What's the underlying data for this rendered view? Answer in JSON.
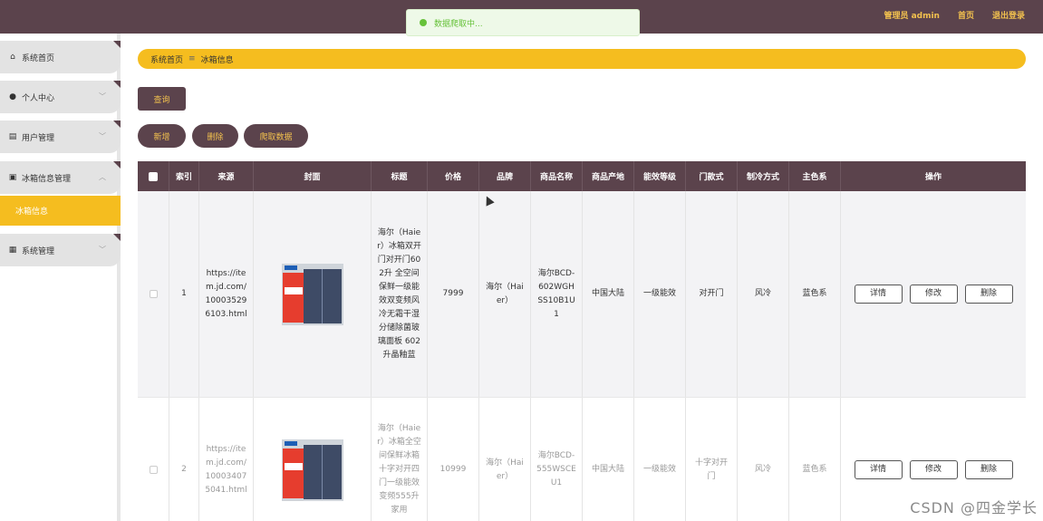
{
  "toast": {
    "text": "数据爬取中..."
  },
  "header": {
    "user": "管理员 admin",
    "home": "首页",
    "logout": "退出登录"
  },
  "sidebar": {
    "items": [
      {
        "label": "系统首页",
        "icon": "home-icon"
      },
      {
        "label": "个人中心",
        "icon": "user-icon"
      },
      {
        "label": "用户管理",
        "icon": "document-icon"
      },
      {
        "label": "冰箱信息管理",
        "icon": "briefcase-icon"
      },
      {
        "label": "系统管理",
        "icon": "grid-icon"
      }
    ],
    "active_sub": "冰箱信息"
  },
  "breadcrumb": {
    "home": "系统首页",
    "sep": "≡",
    "current": "冰箱信息"
  },
  "buttons": {
    "search": "查询",
    "add": "新增",
    "delete": "删除",
    "crawl": "爬取数据"
  },
  "table": {
    "headers": [
      "索引",
      "来源",
      "封面",
      "标题",
      "价格",
      "品牌",
      "商品名称",
      "商品产地",
      "能效等级",
      "门款式",
      "制冷方式",
      "主色系",
      "操作"
    ],
    "rows": [
      {
        "index": "1",
        "source": "https://item.jd.com/100035296103.html",
        "title": "海尔（Haier）冰箱双开门对开门602升 全空间保鲜一级能效双变频风冷无霜干湿分储除菌玻璃面板 602升晶釉蓝",
        "price": "7999",
        "brand": "海尔（Haier）",
        "name": "海尔BCD-602WGHSS10B1U1",
        "origin": "中国大陆",
        "energy": "一级能效",
        "door": "对开门",
        "cooling": "风冷",
        "color": "蓝色系"
      },
      {
        "index": "2",
        "source": "https://item.jd.com/100034075041.html",
        "title": "海尔（Haier）冰箱全空间保鲜冰箱十字对开四门一级能效变频555升家用",
        "price": "10999",
        "brand": "海尔（Haier）",
        "name": "海尔BCD-555WSCEU1",
        "origin": "中国大陆",
        "energy": "一级能效",
        "door": "十字对开门",
        "cooling": "风冷",
        "color": "蓝色系"
      }
    ],
    "actions": {
      "detail": "详情",
      "edit": "修改",
      "delete": "删除"
    }
  },
  "watermark": "CSDN @四金学长"
}
